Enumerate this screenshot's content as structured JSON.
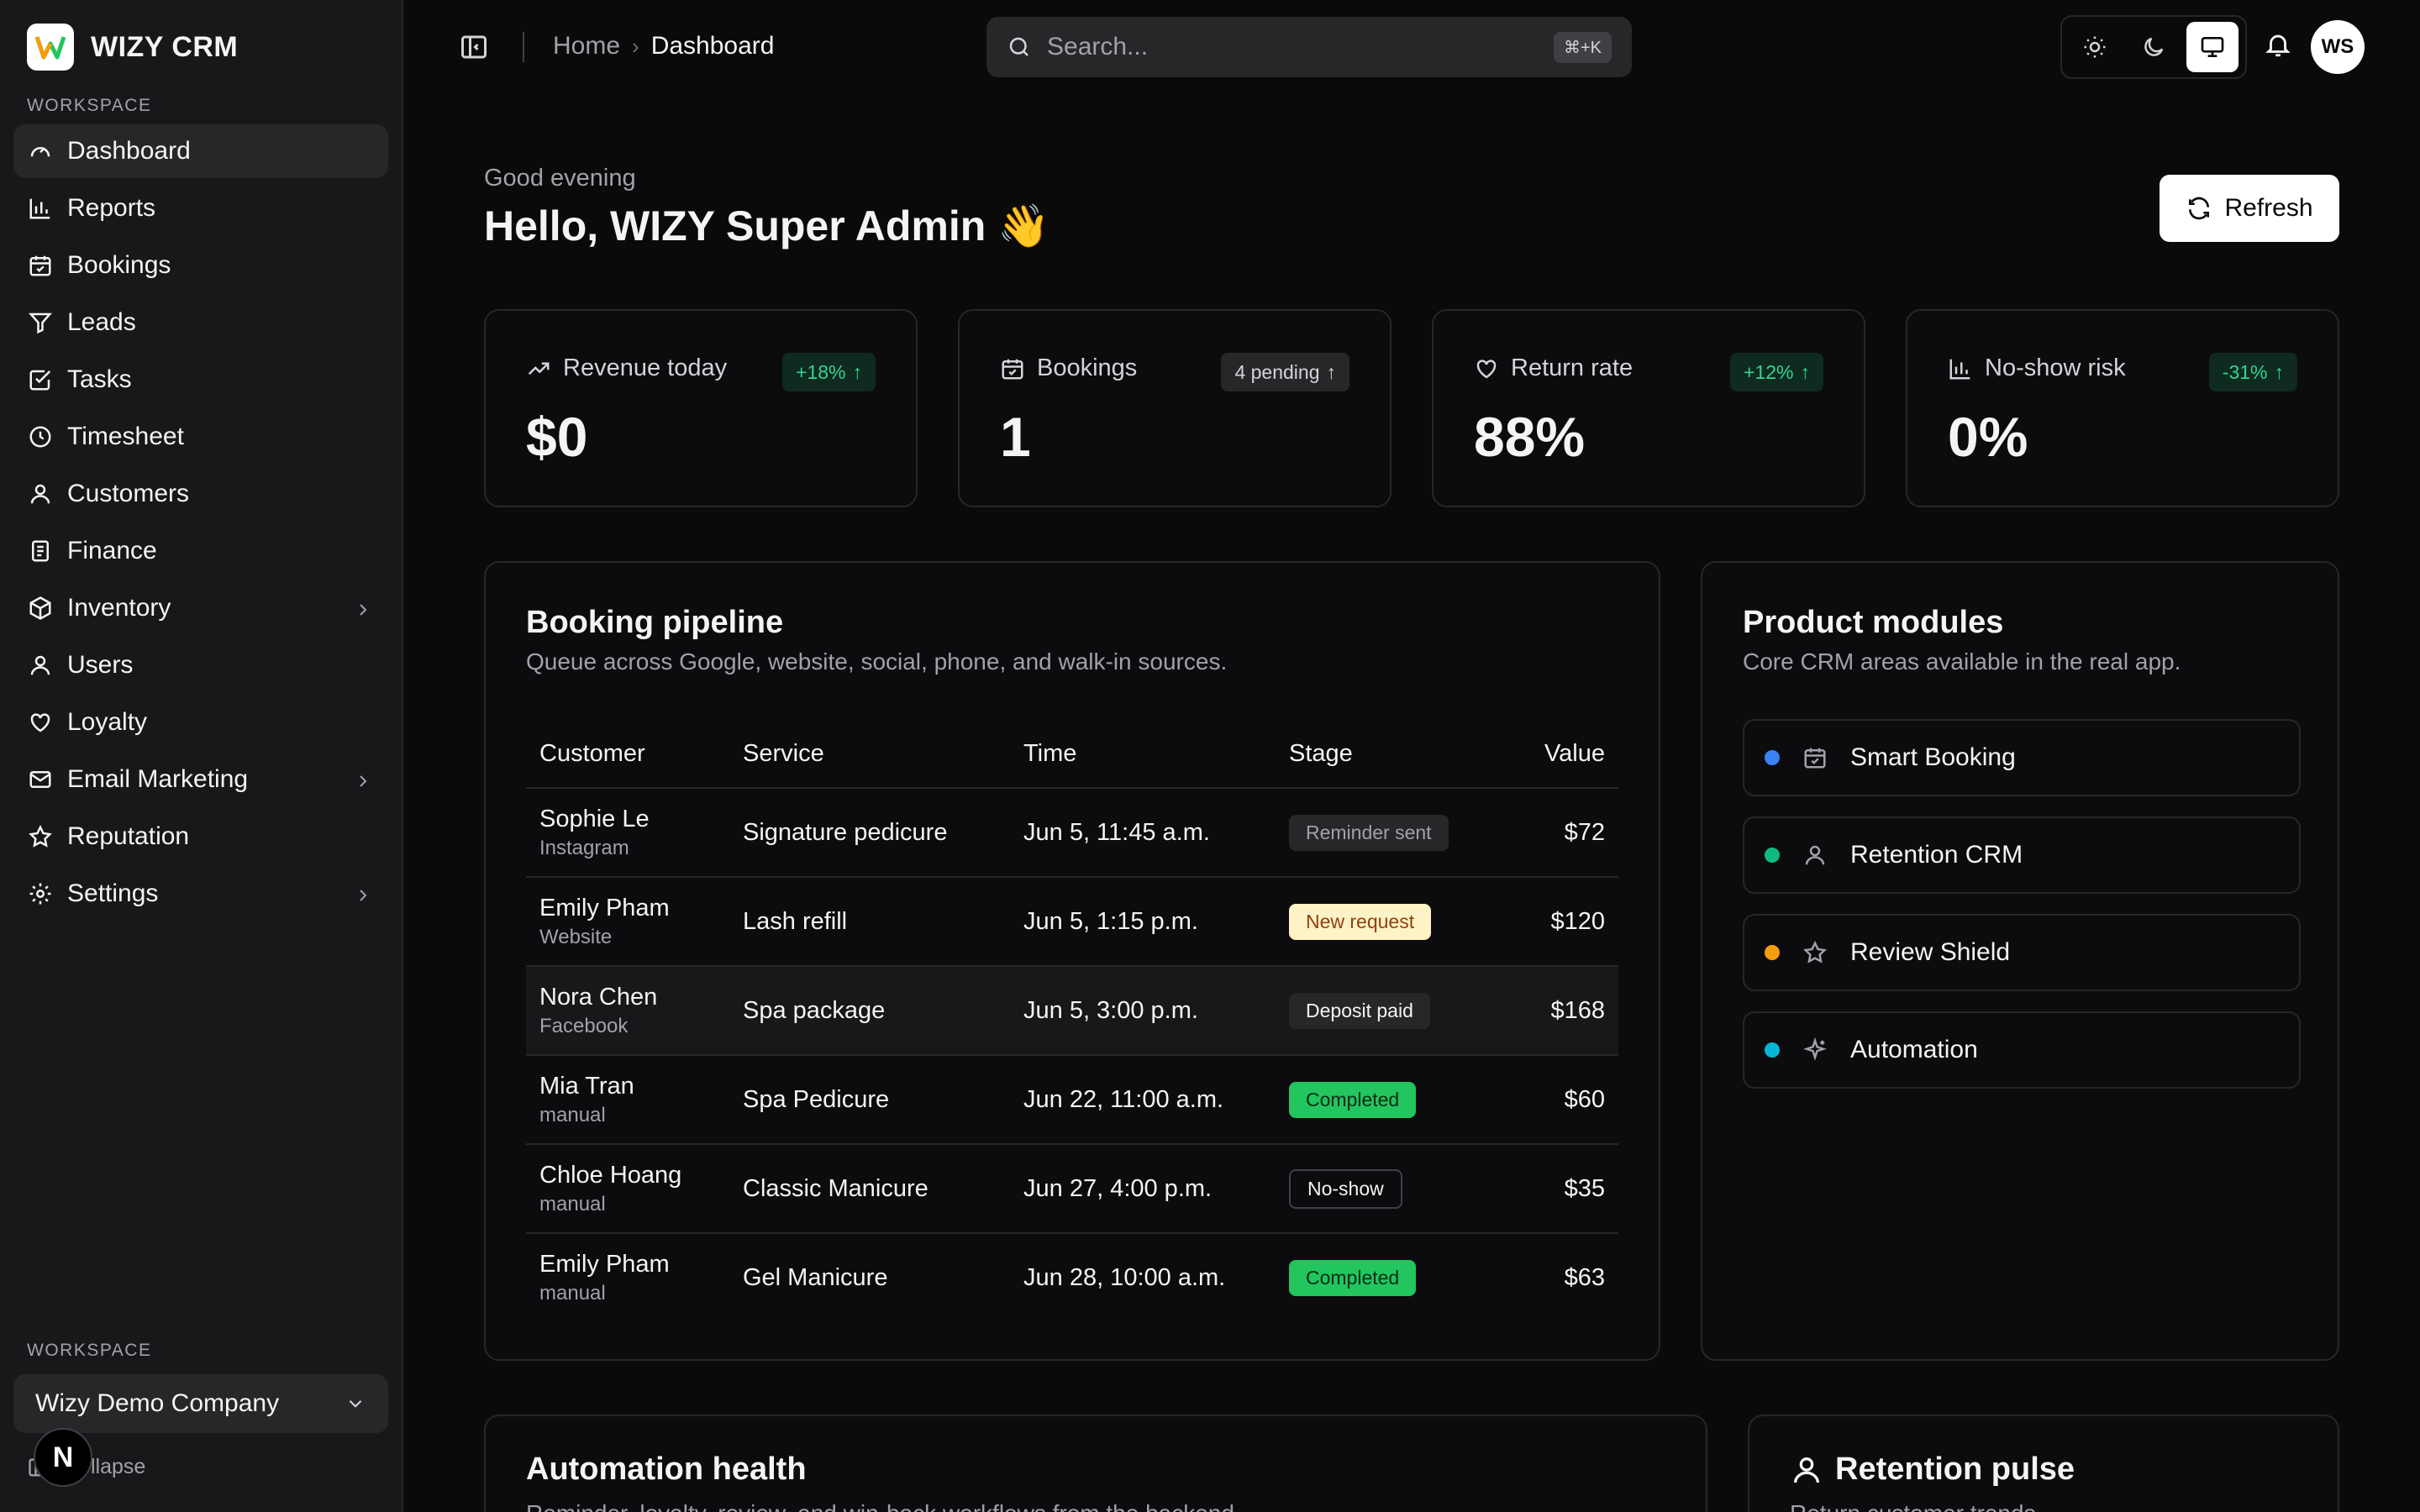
{
  "brand": {
    "name": "WIZY CRM"
  },
  "sidebar": {
    "section_label": "WORKSPACE",
    "items": [
      {
        "label": "Dashboard",
        "icon": "gauge-icon",
        "active": true
      },
      {
        "label": "Reports",
        "icon": "bar-chart-icon"
      },
      {
        "label": "Bookings",
        "icon": "calendar-check-icon"
      },
      {
        "label": "Leads",
        "icon": "funnel-icon"
      },
      {
        "label": "Tasks",
        "icon": "checkbox-icon"
      },
      {
        "label": "Timesheet",
        "icon": "clock-icon"
      },
      {
        "label": "Customers",
        "icon": "user-icon"
      },
      {
        "label": "Finance",
        "icon": "document-icon"
      },
      {
        "label": "Inventory",
        "icon": "box-icon",
        "has_children": true
      },
      {
        "label": "Users",
        "icon": "user-icon"
      },
      {
        "label": "Loyalty",
        "icon": "heart-hand-icon"
      },
      {
        "label": "Email Marketing",
        "icon": "mail-icon",
        "has_children": true
      },
      {
        "label": "Reputation",
        "icon": "star-icon"
      },
      {
        "label": "Settings",
        "icon": "gear-icon",
        "has_children": true
      }
    ],
    "footer_label": "WORKSPACE",
    "workspace_name": "Wizy Demo Company",
    "collapse_label": "Collapse",
    "badge_letter": "N"
  },
  "topbar": {
    "breadcrumb_home": "Home",
    "breadcrumb_current": "Dashboard",
    "search_placeholder": "Search...",
    "search_shortcut": "⌘+K",
    "theme_active": "system",
    "avatar_initials": "WS"
  },
  "greeting": {
    "small": "Good evening",
    "big": "Hello, WIZY Super Admin 👋"
  },
  "refresh_label": "Refresh",
  "stats": [
    {
      "label": "Revenue today",
      "icon": "trend-up-icon",
      "badge": "+18%",
      "badge_style": "green",
      "value": "$0"
    },
    {
      "label": "Bookings",
      "icon": "calendar-check-icon",
      "badge": "4 pending",
      "badge_style": "gray",
      "value": "1"
    },
    {
      "label": "Return rate",
      "icon": "heart-hand-icon",
      "badge": "+12%",
      "badge_style": "green",
      "value": "88%"
    },
    {
      "label": "No-show risk",
      "icon": "bar-chart-icon",
      "badge": "-31%",
      "badge_style": "green",
      "value": "0%"
    }
  ],
  "pipeline": {
    "title": "Booking pipeline",
    "subtitle": "Queue across Google, website, social, phone, and walk-in sources.",
    "columns": [
      "Customer",
      "Service",
      "Time",
      "Stage",
      "Value"
    ],
    "rows": [
      {
        "name": "Sophie Le",
        "source": "Instagram",
        "service": "Signature pedicure",
        "time": "Jun 5, 11:45 a.m.",
        "stage": "Reminder sent",
        "stage_style": "reminder",
        "value": "$72"
      },
      {
        "name": "Emily Pham",
        "source": "Website",
        "service": "Lash refill",
        "time": "Jun 5, 1:15 p.m.",
        "stage": "New request",
        "stage_style": "new",
        "value": "$120"
      },
      {
        "name": "Nora Chen",
        "source": "Facebook",
        "service": "Spa package",
        "time": "Jun 5, 3:00 p.m.",
        "stage": "Deposit paid",
        "stage_style": "deposit",
        "value": "$168",
        "highlight": true
      },
      {
        "name": "Mia Tran",
        "source": "manual",
        "service": "Spa Pedicure",
        "time": "Jun 22, 11:00 a.m.",
        "stage": "Completed",
        "stage_style": "completed",
        "value": "$60"
      },
      {
        "name": "Chloe Hoang",
        "source": "manual",
        "service": "Classic Manicure",
        "time": "Jun 27, 4:00 p.m.",
        "stage": "No-show",
        "stage_style": "noshow",
        "value": "$35"
      },
      {
        "name": "Emily Pham",
        "source": "manual",
        "service": "Gel Manicure",
        "time": "Jun 28, 10:00 a.m.",
        "stage": "Completed",
        "stage_style": "completed",
        "value": "$63"
      }
    ]
  },
  "modules": {
    "title": "Product modules",
    "subtitle": "Core CRM areas available in the real app.",
    "items": [
      {
        "label": "Smart Booking",
        "dot_color": "#3b82f6",
        "icon": "calendar-check-icon"
      },
      {
        "label": "Retention CRM",
        "dot_color": "#10b981",
        "icon": "user-icon"
      },
      {
        "label": "Review Shield",
        "dot_color": "#f59e0b",
        "icon": "star-icon"
      },
      {
        "label": "Automation",
        "dot_color": "#06b6d4",
        "icon": "sparkle-icon"
      }
    ]
  },
  "bottom": {
    "automation_title": "Automation health",
    "automation_sub": "Reminder, loyalty, review, and win-back workflows from the backend.",
    "retention_title": "Retention pulse",
    "retention_sub": "Return customer trends"
  }
}
